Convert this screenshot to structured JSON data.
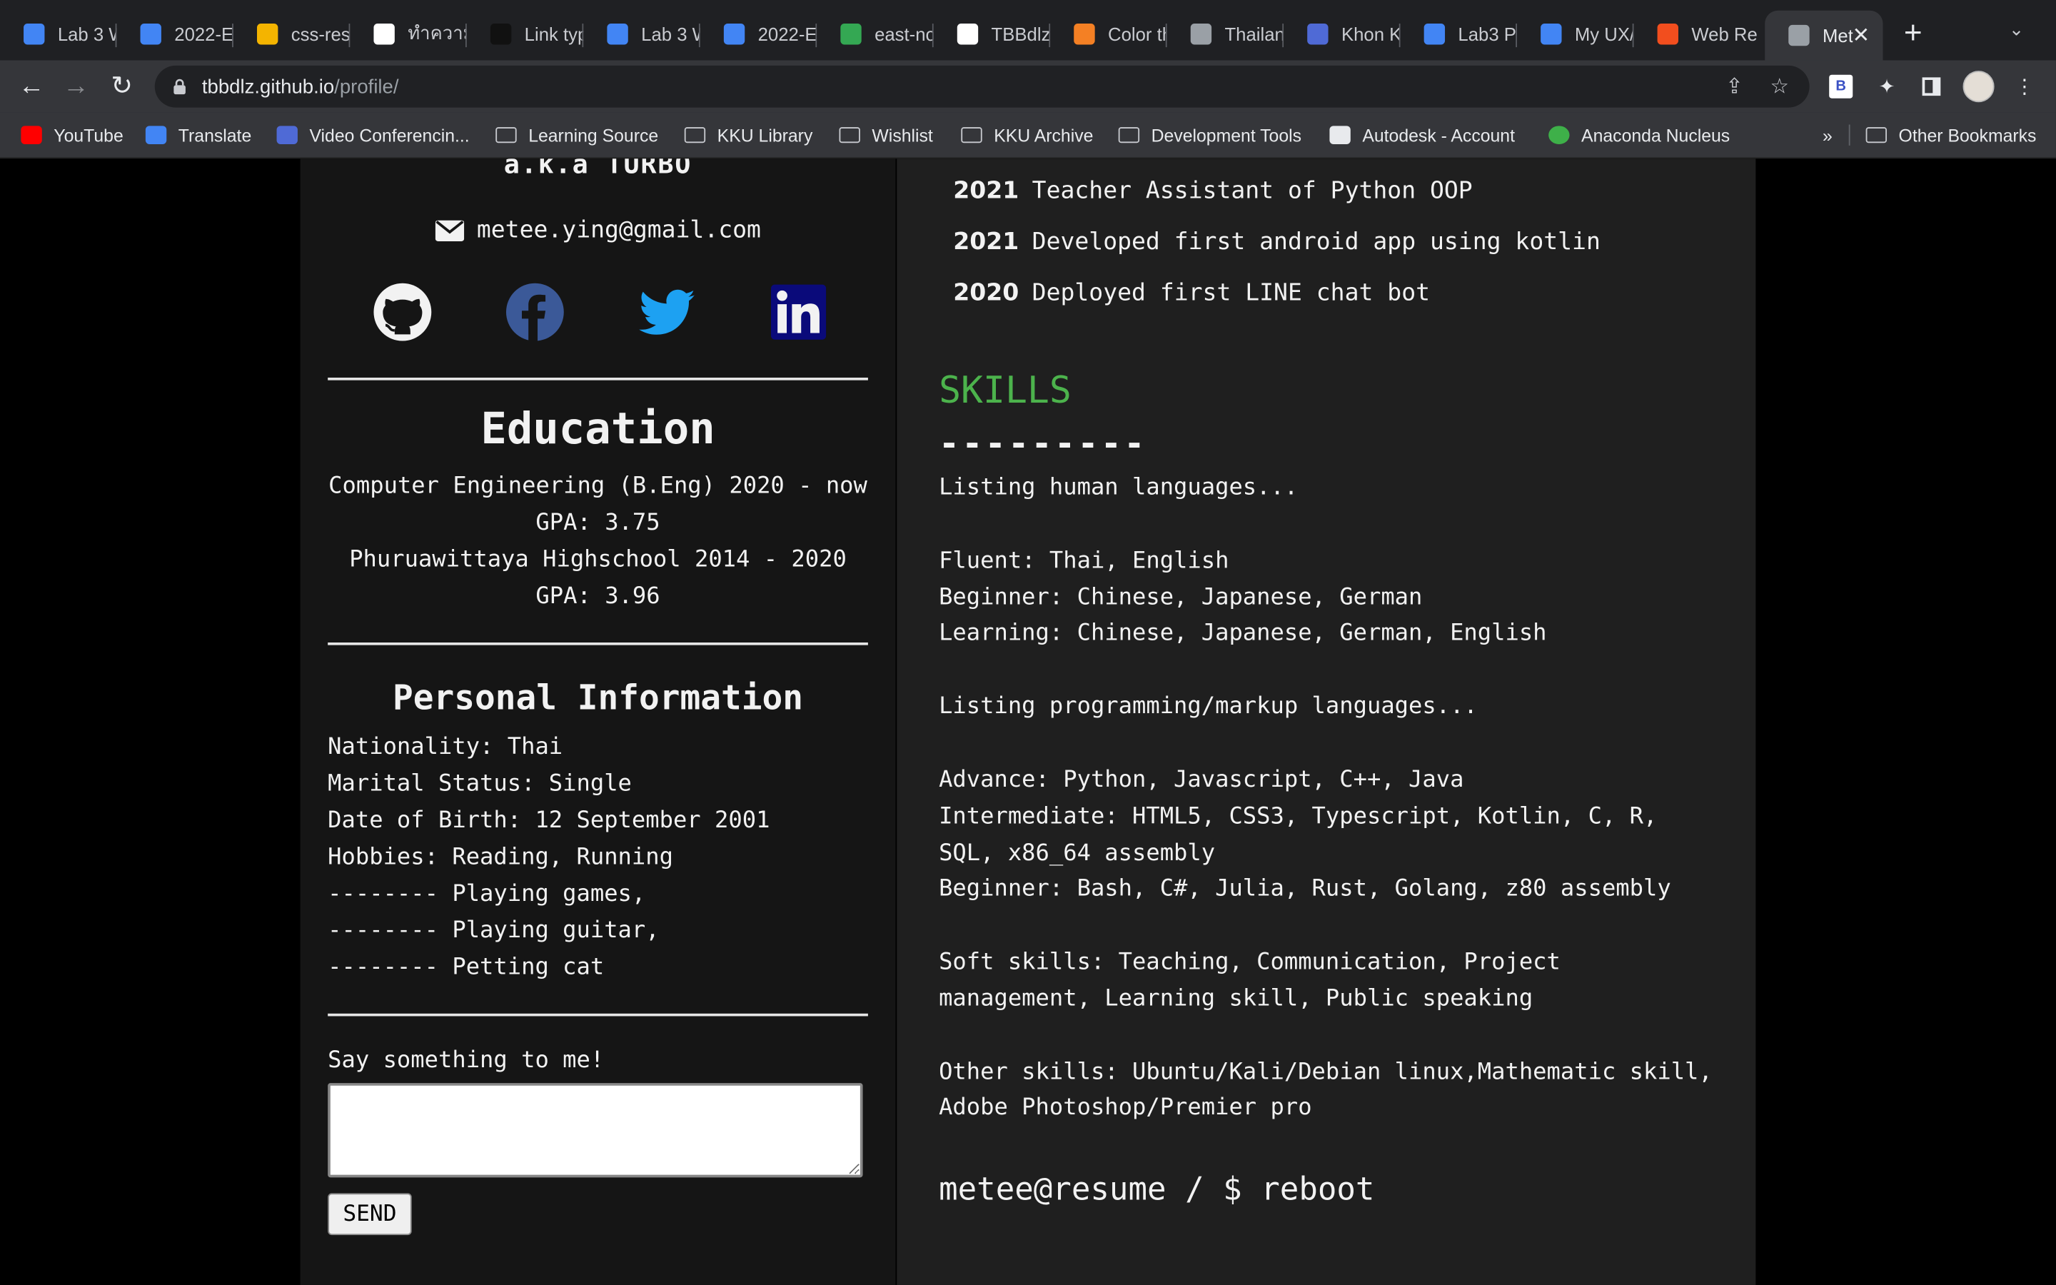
{
  "browser": {
    "tabs": [
      {
        "title": "Lab 3 W",
        "icon": "google-classroom-icon",
        "color": "#4285f4"
      },
      {
        "title": "2022-E",
        "icon": "google-docs-icon",
        "color": "#4285f4"
      },
      {
        "title": "css-res",
        "icon": "google-slides-icon",
        "color": "#f4b400"
      },
      {
        "title": "ทำความ",
        "icon": "cc-icon",
        "color": "#ffffff"
      },
      {
        "title": "Link typ",
        "icon": "medium-icon",
        "color": "#111111"
      },
      {
        "title": "Lab 3 W",
        "icon": "google-classroom-icon",
        "color": "#4285f4"
      },
      {
        "title": "2022-E",
        "icon": "google-docs-icon",
        "color": "#4285f4"
      },
      {
        "title": "east-no",
        "icon": "google-drive-icon",
        "color": "#34a853"
      },
      {
        "title": "TBBdlz",
        "icon": "github-icon",
        "color": "#ffffff"
      },
      {
        "title": "Color th",
        "icon": "stackoverflow-icon",
        "color": "#f48024"
      },
      {
        "title": "Thailan",
        "icon": "globe-icon",
        "color": "#9aa0a6"
      },
      {
        "title": "Khon K",
        "icon": "calendar-icon",
        "color": "#4f6ad6"
      },
      {
        "title": "Lab3 P",
        "icon": "google-docs-icon",
        "color": "#4285f4"
      },
      {
        "title": "My UX/",
        "icon": "google-docs-icon",
        "color": "#4285f4"
      },
      {
        "title": "Web Re",
        "icon": "figma-icon",
        "color": "#f24e1e"
      },
      {
        "title": "Met",
        "icon": "globe-icon",
        "color": "#9aa0a6",
        "active": true
      }
    ],
    "url_host": "tbbdlz.github.io",
    "url_path": "/profile/",
    "bookmarks": [
      {
        "label": "YouTube",
        "icon": "youtube-icon"
      },
      {
        "label": "Translate",
        "icon": "google-translate-icon"
      },
      {
        "label": "Video Conferencin...",
        "icon": "video-icon"
      },
      {
        "label": "Learning Source",
        "icon": "folder-icon"
      },
      {
        "label": "KKU Library",
        "icon": "folder-icon"
      },
      {
        "label": "Wishlist",
        "icon": "folder-icon"
      },
      {
        "label": "KKU Archive",
        "icon": "folder-icon"
      },
      {
        "label": "Development Tools",
        "icon": "folder-icon"
      },
      {
        "label": "Autodesk - Account",
        "icon": "autodesk-icon"
      },
      {
        "label": "Anaconda Nucleus",
        "icon": "anaconda-icon"
      }
    ],
    "overflow": "»",
    "other_bookmarks": "Other Bookmarks",
    "extension_badge": "B"
  },
  "profile": {
    "aka": "a.k.a TURBO",
    "email": "metee.ying@gmail.com",
    "social": [
      "github-icon",
      "facebook-icon",
      "twitter-icon",
      "linkedin-icon"
    ],
    "education": {
      "heading": "Education",
      "lines": [
        "Computer Engineering (B.Eng) 2020 - now",
        "GPA: 3.75",
        "Phuruawittaya Highschool 2014 - 2020",
        "GPA: 3.96"
      ]
    },
    "personal": {
      "heading": "Personal Information",
      "lines": [
        "Nationality: Thai",
        "Marital Status: Single",
        "Date of Birth: 12 September 2001",
        "Hobbies: Reading, Running",
        "-------- Playing games,",
        "-------- Playing guitar,",
        "-------- Petting cat"
      ]
    },
    "contact": {
      "prompt": "Say something to me!",
      "message_value": "",
      "send_label": "SEND"
    }
  },
  "timeline": [
    {
      "year": "2021",
      "text": "Teacher Assistant of Python OOP"
    },
    {
      "year": "2021",
      "text": "Developed first android app using kotlin"
    },
    {
      "year": "2020",
      "text": "Deployed first LINE chat bot"
    }
  ],
  "skills": {
    "heading": "SKILLS",
    "divider": "---------",
    "lines": [
      "Listing human languages...",
      "",
      "Fluent: Thai, English",
      "Beginner: Chinese, Japanese, German",
      "Learning: Chinese, Japanese, German, English",
      "",
      "Listing programming/markup languages...",
      "",
      "Advance: Python, Javascript, C++, Java",
      "Intermediate: HTML5, CSS3, Typescript, Kotlin, C, R,",
      "SQL, x86_64 assembly",
      "Beginner: Bash, C#, Julia, Rust, Golang, z80 assembly",
      "",
      "Soft skills: Teaching, Communication, Project",
      "management, Learning skill, Public speaking",
      "",
      "Other skills: Ubuntu/Kali/Debian linux,Mathematic skill,",
      "Adobe Photoshop/Premier pro"
    ],
    "terminal": "metee@resume / $ reboot"
  },
  "colors": {
    "skills_heading": "#4cb34c",
    "facebook": "#3b5998",
    "twitter": "#1da1f2",
    "linkedin_bg": "#0a0a7a"
  }
}
